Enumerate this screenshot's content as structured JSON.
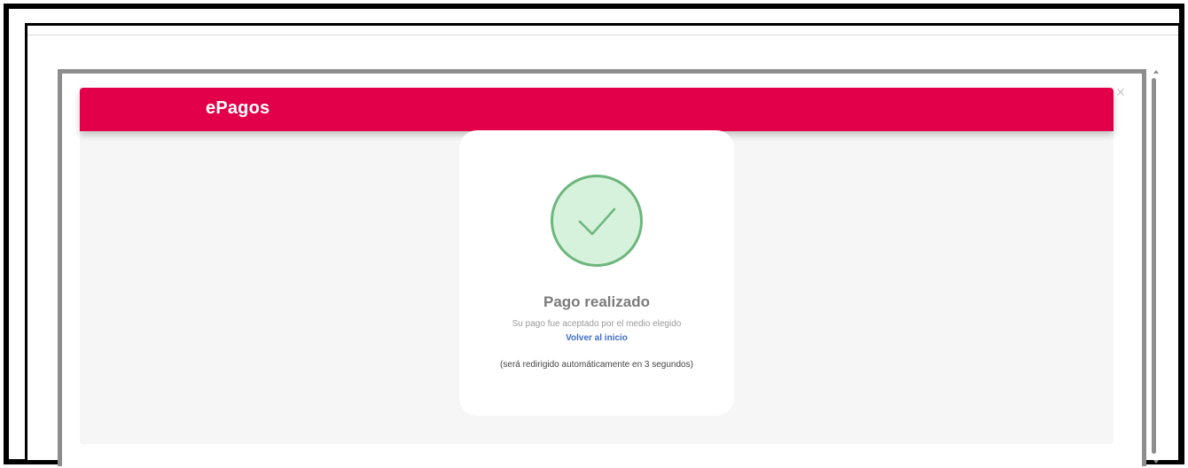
{
  "header": {
    "brand": "ePagos"
  },
  "result": {
    "title": "Pago realizado",
    "message": "Su pago fue aceptado por el medio elegido",
    "link_label": "Volver al inicio",
    "redirect_note": "(será redirigido automáticamente en 3 segundos)"
  },
  "icons": {
    "success": "check-icon",
    "close": "close-icon"
  },
  "colors": {
    "brand": "#e3004a",
    "success_fill": "#d6f2dc",
    "success_stroke": "#6db67c",
    "link": "#3f6fc6"
  }
}
